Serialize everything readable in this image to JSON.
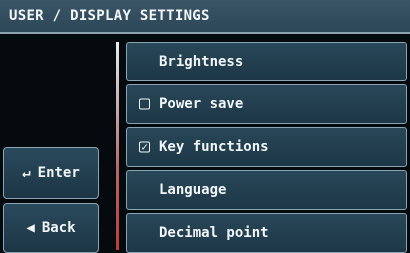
{
  "header": {
    "title": "USER / DISPLAY SETTINGS"
  },
  "buttons": {
    "enter": {
      "icon": "enter-return-icon",
      "glyph": "↵",
      "label": "Enter"
    },
    "back": {
      "icon": "back-triangle-icon",
      "glyph": "◀",
      "label": "Back"
    }
  },
  "menu": {
    "items": [
      {
        "label": "Brightness",
        "checkbox": null
      },
      {
        "label": "Power save",
        "checkbox": false,
        "box_glyph": ""
      },
      {
        "label": "Key functions",
        "checkbox": true,
        "box_glyph": "✓"
      },
      {
        "label": "Language",
        "checkbox": null
      },
      {
        "label": "Decimal point",
        "checkbox": null
      }
    ]
  },
  "colors": {
    "background": "#050a0e",
    "title_bar": "#2c4757",
    "button_fill": "#1d3747",
    "button_border": "#8aa4b2",
    "text": "#f2f6f8",
    "divider_accent": "#c03a3a"
  }
}
